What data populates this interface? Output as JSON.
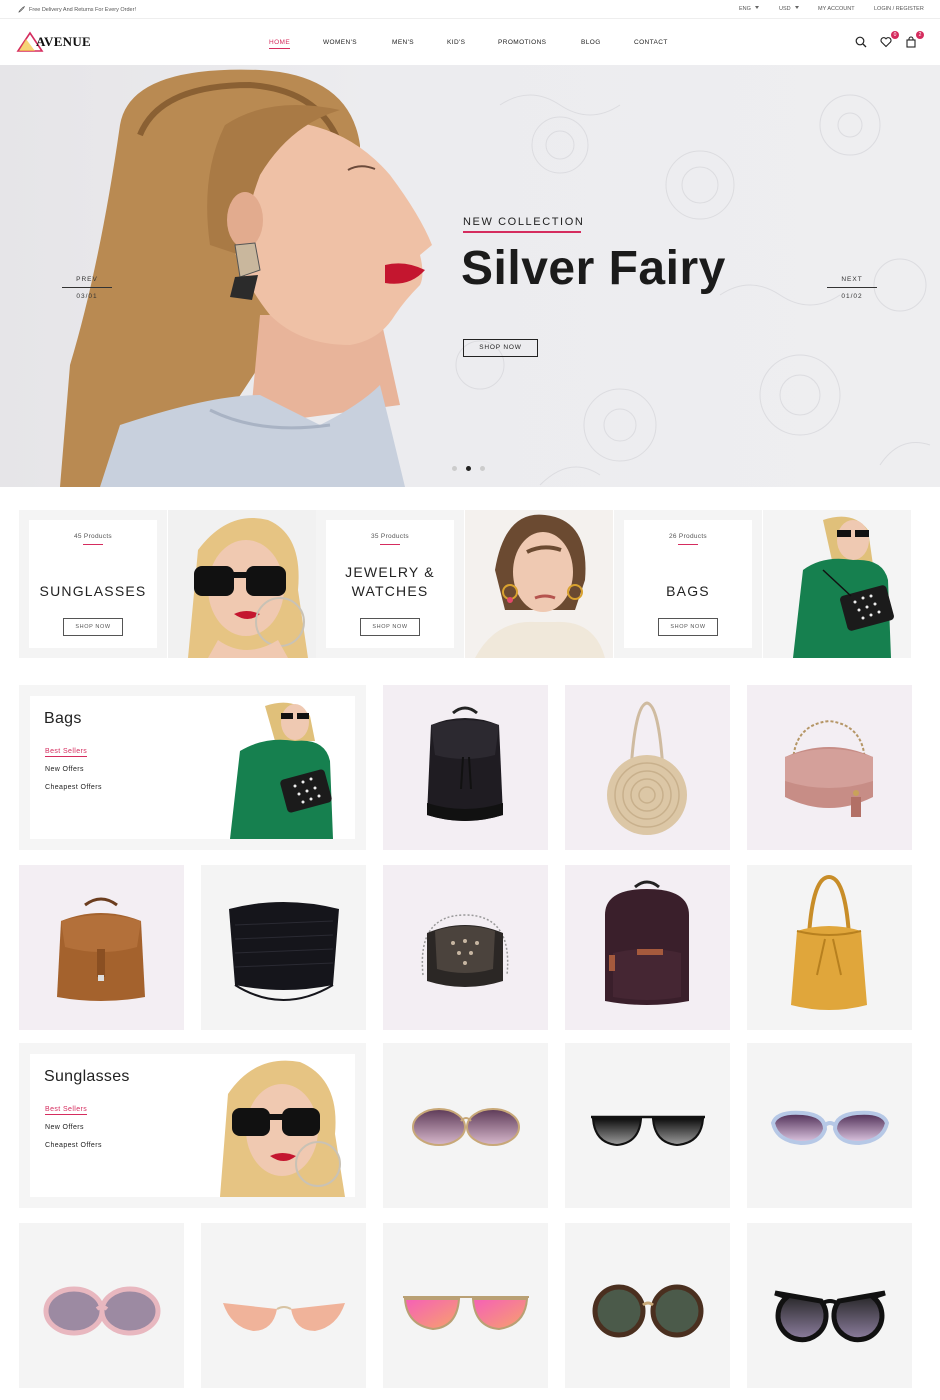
{
  "topbar": {
    "shipping": "Free Delivery And Returns For Every Order!",
    "language": "ENG",
    "currency": "USD",
    "account": "MY ACCOUNT",
    "login": "LOGIN / REGISTER"
  },
  "header": {
    "logo": "AVENUE",
    "nav": [
      "HOME",
      "WOMEN'S",
      "MEN'S",
      "KID'S",
      "PROMOTIONS",
      "BLOG",
      "CONTACT"
    ],
    "wishlist_count": "0",
    "cart_count": "2"
  },
  "hero": {
    "kicker": "NEW COLLECTION",
    "title": "Silver Fairy",
    "button": "SHOP NOW",
    "prev_label": "PREV",
    "prev_count": "03/01",
    "next_label": "NEXT",
    "next_count": "01/02",
    "dots": 3,
    "active_dot": 2
  },
  "categories": [
    {
      "count": "45 Products",
      "name": "SUNGLASSES",
      "button": "SHOP NOW"
    },
    {
      "count": "35 Products",
      "name_line1": "JEWELRY &",
      "name_line2": "WATCHES",
      "button": "SHOP NOW"
    },
    {
      "count": "26 Products",
      "name": "BAGS",
      "button": "SHOP NOW"
    }
  ],
  "bags": {
    "title": "Bags",
    "links": [
      "Best Sellers",
      "New Offers",
      "Cheapest Offers"
    ]
  },
  "sunglasses": {
    "title": "Sunglasses",
    "links": [
      "Best Sellers",
      "New Offers",
      "Cheapest Offers"
    ]
  },
  "colors": {
    "accent": "#d52c5e",
    "tile_lilac": "#f3eef3",
    "tile_grey": "#f4f4f4"
  }
}
